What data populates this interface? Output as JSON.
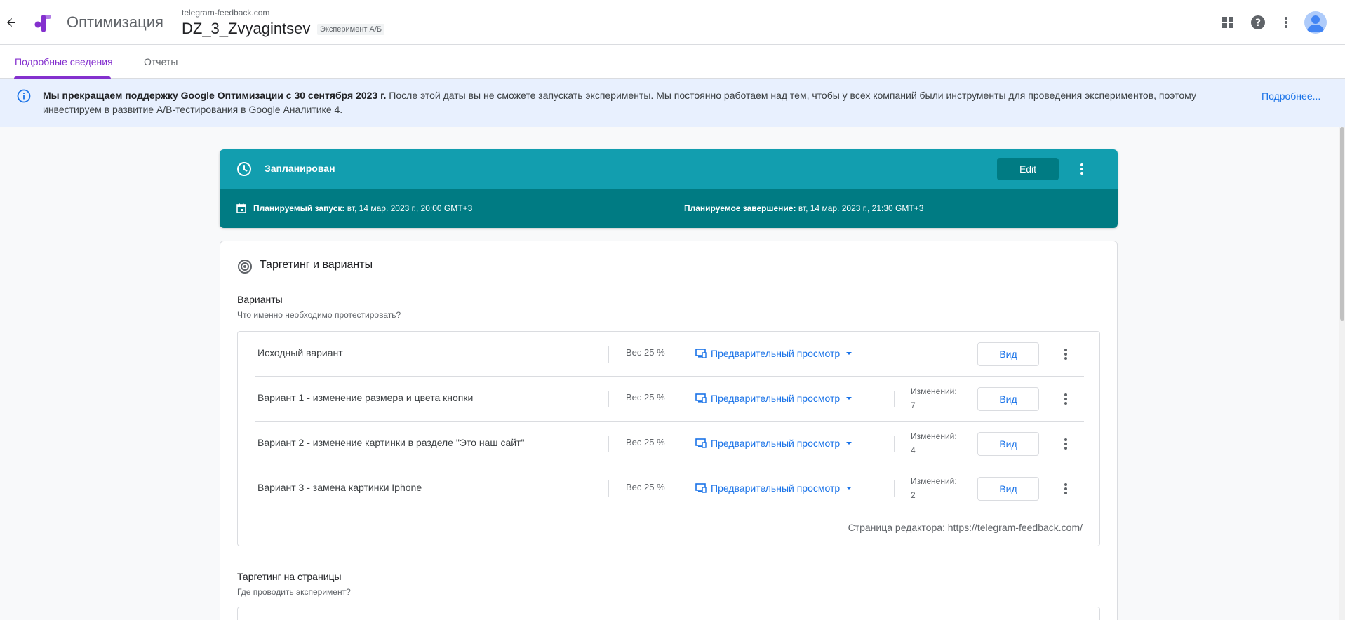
{
  "header": {
    "app_name": "Оптимизация",
    "container": "telegram-feedback.com",
    "experiment_name": "DZ_3_Zvyagintsev",
    "experiment_type": "Эксперимент A/Б"
  },
  "tabs": [
    {
      "label": "Подробные сведения",
      "active": true
    },
    {
      "label": "Отчеты",
      "active": false
    }
  ],
  "banner": {
    "bold": "Мы прекращаем поддержку Google Оптимизации с 30 сентября 2023 г.",
    "text": " После этой даты вы не сможете запускать эксперименты. Мы постоянно работаем над тем, чтобы у всех компаний были инструменты для проведения экспериментов, поэтому инвестируем в развитие A/B-тестирования в Google Аналитике 4.",
    "link": "Подробнее..."
  },
  "status": {
    "label": "Запланирован",
    "edit_label": "Edit",
    "start_label": "Планируемый запуск:",
    "start_value": "вт, 14 мар. 2023 г., 20:00 GMT+3",
    "end_label": "Планируемое завершение:",
    "end_value": "вт, 14 мар. 2023 г., 21:30 GMT+3"
  },
  "targeting": {
    "title": "Таргетинг и варианты",
    "variants_title": "Варианты",
    "variants_desc": "Что именно необходимо протестировать?",
    "variants": [
      {
        "name": "Исходный вариант",
        "weight": "Вес 25 %",
        "preview": "Предварительный просмотр",
        "changes_label": "",
        "changes": "",
        "view": "Вид"
      },
      {
        "name": "Вариант 1 - изменение размера и цвета кнопки",
        "weight": "Вес 25 %",
        "preview": "Предварительный просмотр",
        "changes_label": "Изменений:",
        "changes": "7",
        "view": "Вид"
      },
      {
        "name": "Вариант 2 - изменение картинки в разделе \"Это наш сайт\"",
        "weight": "Вес 25 %",
        "preview": "Предварительный просмотр",
        "changes_label": "Изменений:",
        "changes": "4",
        "view": "Вид"
      },
      {
        "name": "Вариант 3 - замена картинки Iphone",
        "weight": "Вес 25 %",
        "preview": "Предварительный просмотр",
        "changes_label": "Изменений:",
        "changes": "2",
        "view": "Вид"
      }
    ],
    "editor_page": "Страница редактора: https://telegram-feedback.com/",
    "page_targeting_title": "Таргетинг на страницы",
    "page_targeting_desc": "Где проводить эксперимент?"
  },
  "icons": {
    "accent": "#8430ce",
    "status_color": "#129eaf",
    "status_dark": "#007b83",
    "link_color": "#1a73e8"
  }
}
